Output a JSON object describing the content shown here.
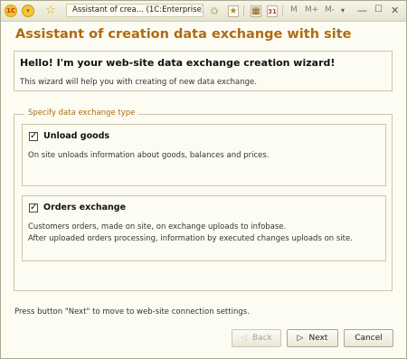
{
  "titlebar": {
    "logo_text": "1С",
    "window_title": "Assistant of crea... (1C:Enterprise)",
    "m_labels": [
      "M",
      "M+",
      "M-"
    ],
    "icons": [
      "1c-logo-icon",
      "main-menu-icon",
      "favorites-star-icon",
      "add-to-favorites-icon",
      "bookmark-icon",
      "calculator-icon",
      "calendar-icon",
      "dropdown-arrow-icon",
      "minimize-icon",
      "maximize-icon",
      "close-icon"
    ],
    "calendar_digit": "31"
  },
  "page": {
    "title": "Assistant of creation data exchange with site"
  },
  "hello": {
    "heading": "Hello! I'm your web-site data exchange creation wizard!",
    "text": "This wizard will help you with creating of new data exchange."
  },
  "exchange_type": {
    "group_label": "Specify data exchange type",
    "options": [
      {
        "label": "Unload goods",
        "checked": true,
        "description": [
          "On site unloads information about goods, balances and prices."
        ]
      },
      {
        "label": "Orders exchange",
        "checked": true,
        "description": [
          "Customers orders, made on site, on exchange uploads to infobase.",
          "After uploaded orders processing, information by executed changes uploads on site."
        ]
      }
    ]
  },
  "footer": {
    "note": "Press button \"Next\" to move to web-site connection settings.",
    "back_label": "Back",
    "next_label": "Next",
    "cancel_label": "Cancel"
  },
  "colors": {
    "accent": "#b06a12",
    "background": "#fdfcf3",
    "border": "#c9c6ab"
  }
}
